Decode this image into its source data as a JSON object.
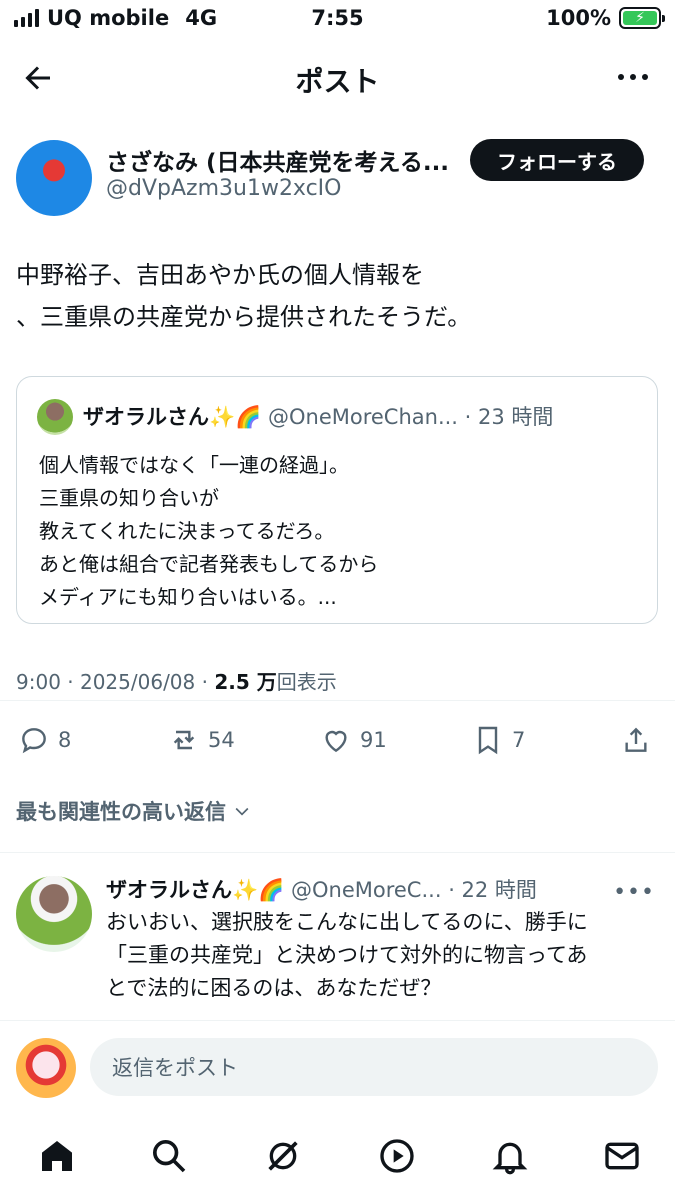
{
  "status_bar": {
    "carrier": "UQ mobile",
    "network": "4G",
    "time": "7:55",
    "battery": "100%"
  },
  "header": {
    "title": "ポスト"
  },
  "author": {
    "name": "さざなみ (日本共産党を考える...",
    "handle": "@dVpAzm3u1w2xcIO",
    "follow_label": "フォローする"
  },
  "tweet": {
    "lines": [
      "中野裕子、吉田あやか氏の個人情報を",
      "、三重県の共産党から提供されたそうだ。"
    ]
  },
  "quote": {
    "name": "ザオラルさん✨🌈",
    "handle": "@OneMoreChan...",
    "time": "· 23 時間",
    "lines": [
      "個人情報ではなく「一連の経過」。",
      "三重県の知り合いが",
      "教えてくれたに決まってるだろ。",
      "あと俺は組合で記者発表もしてるから",
      "メディアにも知り合いはいる。..."
    ]
  },
  "meta": {
    "time": "9:00 · 2025/06/08 · ",
    "views": "2.5 万",
    "views_label": "回表示"
  },
  "actions": {
    "replies": "8",
    "reposts": "54",
    "likes": "91",
    "bookmarks": "7"
  },
  "sort_label": "最も関連性の高い返信",
  "reply": {
    "name": "ザオラルさん✨🌈",
    "handle": "@OneMoreC...",
    "time": "· 22 時間",
    "lines": [
      "おいおい、選択肢をこんなに出してるのに、勝手に",
      "「三重の共産党」と決めつけて対外的に物言ってあ",
      "とで法的に困るのは、あなただぜ？"
    ]
  },
  "compose": {
    "placeholder": "返信をポスト"
  },
  "tabs": [
    "home-icon",
    "search-icon",
    "grok-icon",
    "video-icon",
    "notifications-icon",
    "messages-icon"
  ]
}
